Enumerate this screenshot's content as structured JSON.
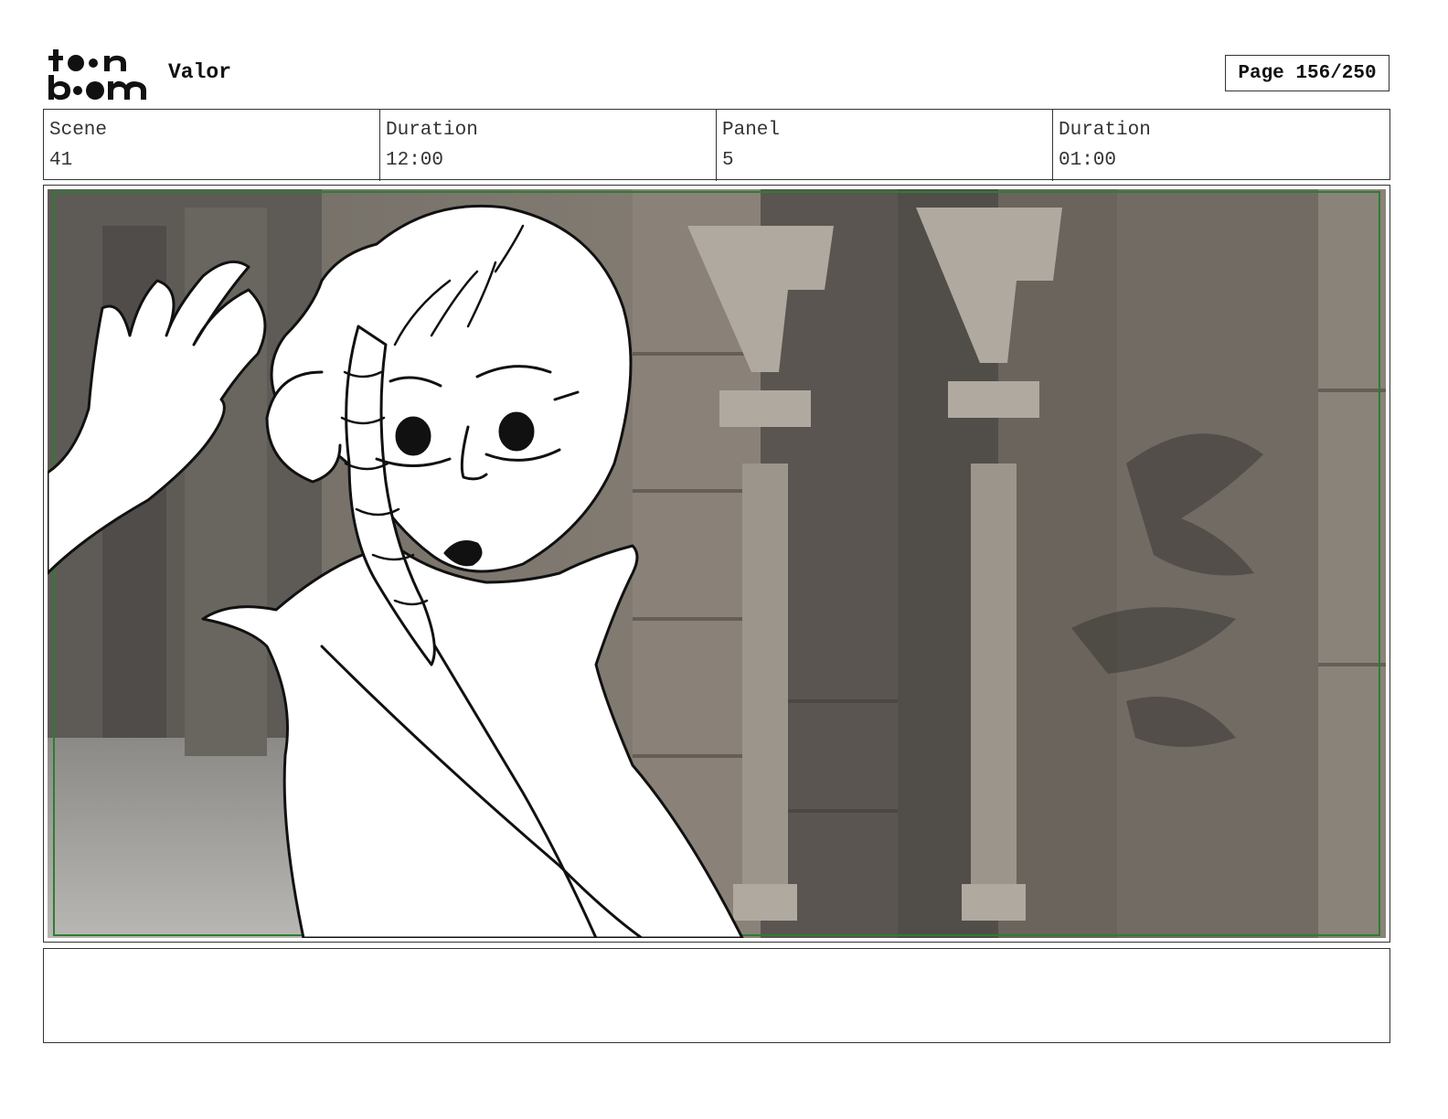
{
  "header": {
    "project_title": "Valor",
    "page_label": "Page 156/250"
  },
  "logo": {
    "icon": "toon-boom-logo"
  },
  "info": {
    "scene_label": "Scene",
    "scene_value": "41",
    "scene_duration_label": "Duration",
    "scene_duration_value": "12:00",
    "panel_label": "Panel",
    "panel_value": "5",
    "panel_duration_label": "Duration",
    "panel_duration_value": "01:00"
  },
  "panel": {
    "description": "",
    "safe_frame_color": "#2e7d32"
  },
  "notes": {
    "text": ""
  }
}
